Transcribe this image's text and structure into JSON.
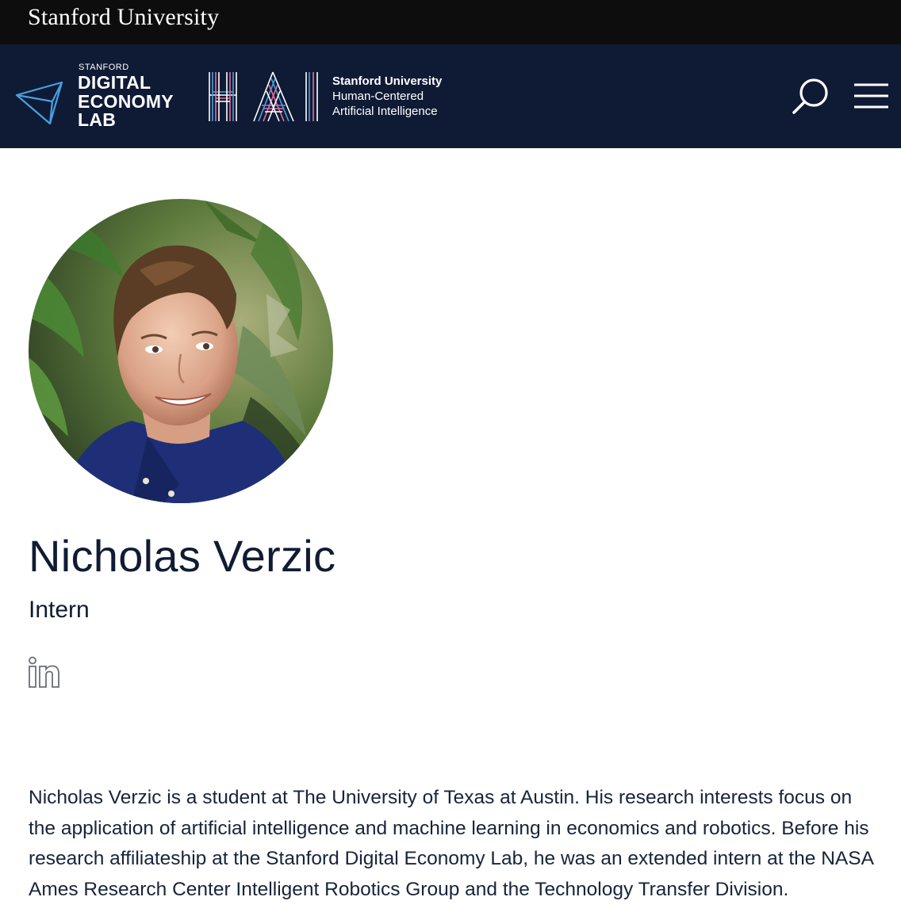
{
  "topbar": {
    "university_name": "Stanford University"
  },
  "header": {
    "lab_logo": {
      "small_text": "STANFORD",
      "line1": "DIGITAL",
      "line2": "ECONOMY",
      "line3": "LAB"
    },
    "hai_logo": {
      "mark": "HAI",
      "line1": "Stanford University",
      "line2": "Human-Centered",
      "line3": "Artificial Intelligence"
    },
    "search_icon": "search-icon",
    "menu_icon": "hamburger-menu-icon",
    "background_color": "#0f1b35"
  },
  "profile": {
    "name": "Nicholas Verzic",
    "role": "Intern",
    "social": [
      {
        "icon": "linkedin-icon",
        "label": "LinkedIn"
      }
    ],
    "bio": "Nicholas Verzic is a student at The University of Texas at Austin. His research interests focus on the application of artificial intelligence and machine learning in economics and robotics. Before his research affiliateship at the Stanford Digital Economy Lab, he was an extended intern at the NASA Ames Research Center Intelligent Robotics Group and the Technology Transfer Division."
  },
  "colors": {
    "topbar_bg": "#0d0d0d",
    "header_bg": "#0f1b35",
    "text_primary": "#0f1c33",
    "accent_blue": "#4a9fe0",
    "accent_pink": "#e86a9a"
  }
}
